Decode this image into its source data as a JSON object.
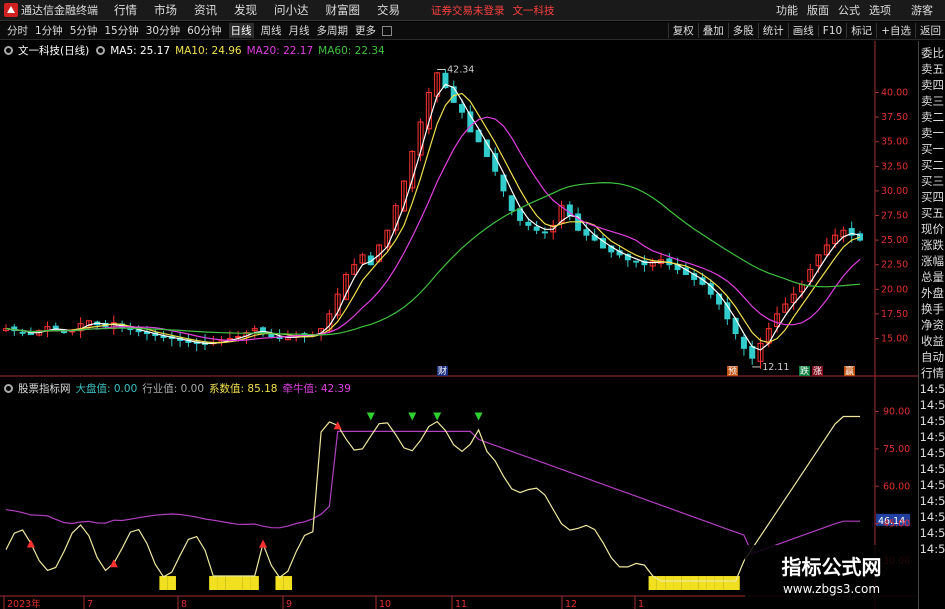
{
  "app": {
    "title": "通达信金融终端"
  },
  "menu": [
    "行情",
    "市场",
    "资讯",
    "发现",
    "问小达",
    "财富圈",
    "交易"
  ],
  "notice": {
    "text1": "证券交易未登录",
    "text2": "文一科技"
  },
  "right_menu": [
    "功能",
    "版面",
    "公式",
    "选项"
  ],
  "guest": "游客",
  "timeframes": [
    "分时",
    "1分钟",
    "5分钟",
    "15分钟",
    "30分钟",
    "60分钟",
    "日线",
    "周线",
    "月线",
    "多周期",
    "更多"
  ],
  "selected_timeframe": "日线",
  "tools": [
    "复权",
    "叠加",
    "多股",
    "统计",
    "画线",
    "F10",
    "标记",
    "+自选",
    "返回"
  ],
  "legend": {
    "stock": "文一科技(日线)",
    "ma5": "MA5: 25.17",
    "ma10": "MA10: 24.96",
    "ma20": "MA20: 22.17",
    "ma60": "MA60: 22.34"
  },
  "indicator_legend": {
    "name": "股票指标网",
    "big_market": "大盘值: 0.00",
    "industry": "行业值: 0.00",
    "coef": "系数值: 85.18",
    "bull": "牵牛值: 42.39"
  },
  "side_panel": [
    "委比",
    "卖五",
    "卖四",
    "卖三",
    "卖二",
    "卖一",
    "买一",
    "买二",
    "买三",
    "买四",
    "买五",
    "现价",
    "涨跌",
    "涨幅",
    "总量",
    "外盘",
    "换手",
    "净资",
    "收益",
    "自动",
    "行情",
    "14:5",
    "14:5",
    "14:5",
    "14:5",
    "14:5",
    "14:5",
    "14:5",
    "14:5",
    "14:5",
    "14:5",
    "14:5"
  ],
  "price_axis": [
    "42.34",
    "40.00",
    "37.50",
    "35.00",
    "32.50",
    "30.00",
    "27.50",
    "25.00",
    "22.50",
    "20.00",
    "17.50",
    "15.00",
    "12.11"
  ],
  "indicator_axis": [
    "90.00",
    "75.00",
    "60.00",
    "46.14",
    "45.00",
    "30.00"
  ],
  "date_axis": [
    "2023年",
    "7",
    "8",
    "9",
    "10",
    "11",
    "12",
    "1"
  ],
  "markers": {
    "cai": "财",
    "yu": "预",
    "die": "跌",
    "zhang": "涨",
    "ying": "赢"
  },
  "watermark": {
    "line1": "指标公式网",
    "line2": "www.zbgs3.com"
  },
  "colors": {
    "ma5": "#ffffff",
    "ma10": "#f0e050",
    "ma20": "#e040e0",
    "ma60": "#40c040",
    "up": "#ff3333",
    "down": "#33cccc"
  },
  "chart_data": {
    "type": "candlestick",
    "ylim": [
      12,
      43
    ],
    "annotations": {
      "high": "42.34",
      "low": "12.11"
    },
    "price_path": [
      16,
      15.8,
      15.6,
      15.4,
      15.8,
      16.2,
      15.9,
      15.6,
      15.8,
      16.5,
      16.8,
      16.4,
      16.2,
      16.6,
      16.1,
      15.9,
      15.7,
      15.5,
      15.3,
      15.1,
      15.0,
      14.8,
      14.6,
      14.5,
      14.4,
      14.6,
      14.8,
      15.0,
      15.2,
      15.6,
      16.0,
      15.6,
      15.2,
      15.0,
      15.1,
      15.3,
      15.2,
      15.4,
      16.0,
      17.5,
      19.5,
      21.5,
      22.5,
      23.5,
      22.5,
      24.5,
      26,
      28.5,
      31,
      34,
      37,
      40,
      42,
      40.5,
      39,
      38,
      36,
      35,
      33.5,
      32,
      30,
      28,
      27,
      26.5,
      26,
      25.8,
      26.5,
      28.5,
      27.5,
      26,
      25.5,
      25,
      24.2,
      23.8,
      23.5,
      23,
      22.8,
      22.5,
      22.8,
      23,
      22.5,
      22,
      21.5,
      21,
      20.5,
      19.5,
      18.5,
      17,
      15.5,
      14,
      13,
      14.5,
      16,
      17.5,
      18.5,
      19.5,
      20.5,
      22,
      23.5,
      24.5,
      25.5,
      26,
      25.5,
      25
    ]
  }
}
